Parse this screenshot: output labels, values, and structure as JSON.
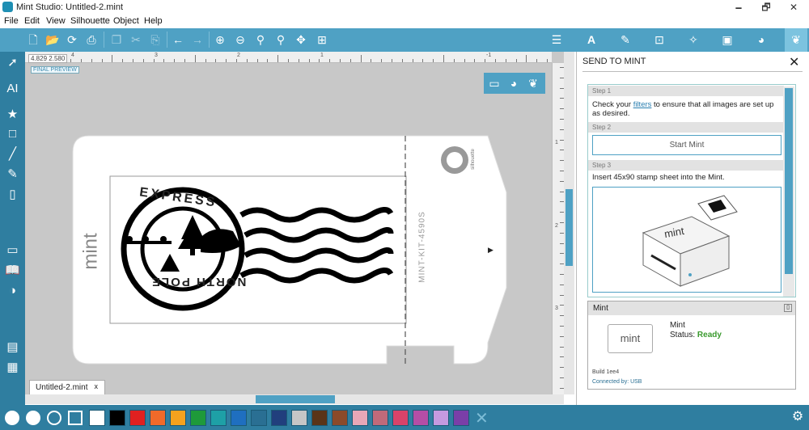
{
  "window": {
    "title": "Mint Studio: Untitled-2.mint",
    "minimize": "🗕",
    "maximize": "🗗",
    "close": "✕"
  },
  "menu": [
    "File",
    "Edit",
    "View",
    "Silhouette",
    "Object",
    "Help"
  ],
  "ruler": {
    "coord_x": "4.829",
    "coord_y": "2.580",
    "top_numbers": [
      "4",
      "3",
      "2",
      "1",
      "-1"
    ],
    "side_numbers": [
      "1",
      "2",
      "3"
    ]
  },
  "canvas": {
    "final_preview": "FINAL PREVIEW",
    "stamp_top_text": "EXPRESS",
    "stamp_bottom_text": "NORTH POLE",
    "kit_code": "MINT-KIT-4590S",
    "brand_side": "mint",
    "brand_logo_text": "silhouette",
    "arrow": "▶"
  },
  "tab": {
    "name": "Untitled-2.mint",
    "close": "x"
  },
  "panel": {
    "title": "SEND TO MINT",
    "close": "✕",
    "step1": {
      "label": "Step 1",
      "text_before": "Check your ",
      "link": "filters",
      "text_after": " to ensure that all images are set up as desired."
    },
    "step2": {
      "label": "Step 2",
      "button": "Start Mint"
    },
    "step3": {
      "label": "Step 3",
      "text": "Insert 45x90 stamp sheet into the Mint."
    },
    "device": {
      "header": "Mint",
      "name": "Mint",
      "status_label": "Status:",
      "status_value": "Ready",
      "build": "Build 1ee4",
      "connected": "Connected by: USB",
      "logo": "mint",
      "illustration_logo": "mint"
    }
  },
  "palette": [
    "#000000",
    "#e02020",
    "#f06a2a",
    "#f5a21e",
    "#1e9a3a",
    "#1ea0a6",
    "#1f6fc0",
    "#2a6f93",
    "#213f7d",
    "#c6c6c6",
    "#5a3419",
    "#8b4a2a",
    "#e8a7b7",
    "#c06a7a",
    "#d9436a",
    "#b54ea6",
    "#c59ae0",
    "#7a3fa8"
  ],
  "accent": "#4fa1c4"
}
